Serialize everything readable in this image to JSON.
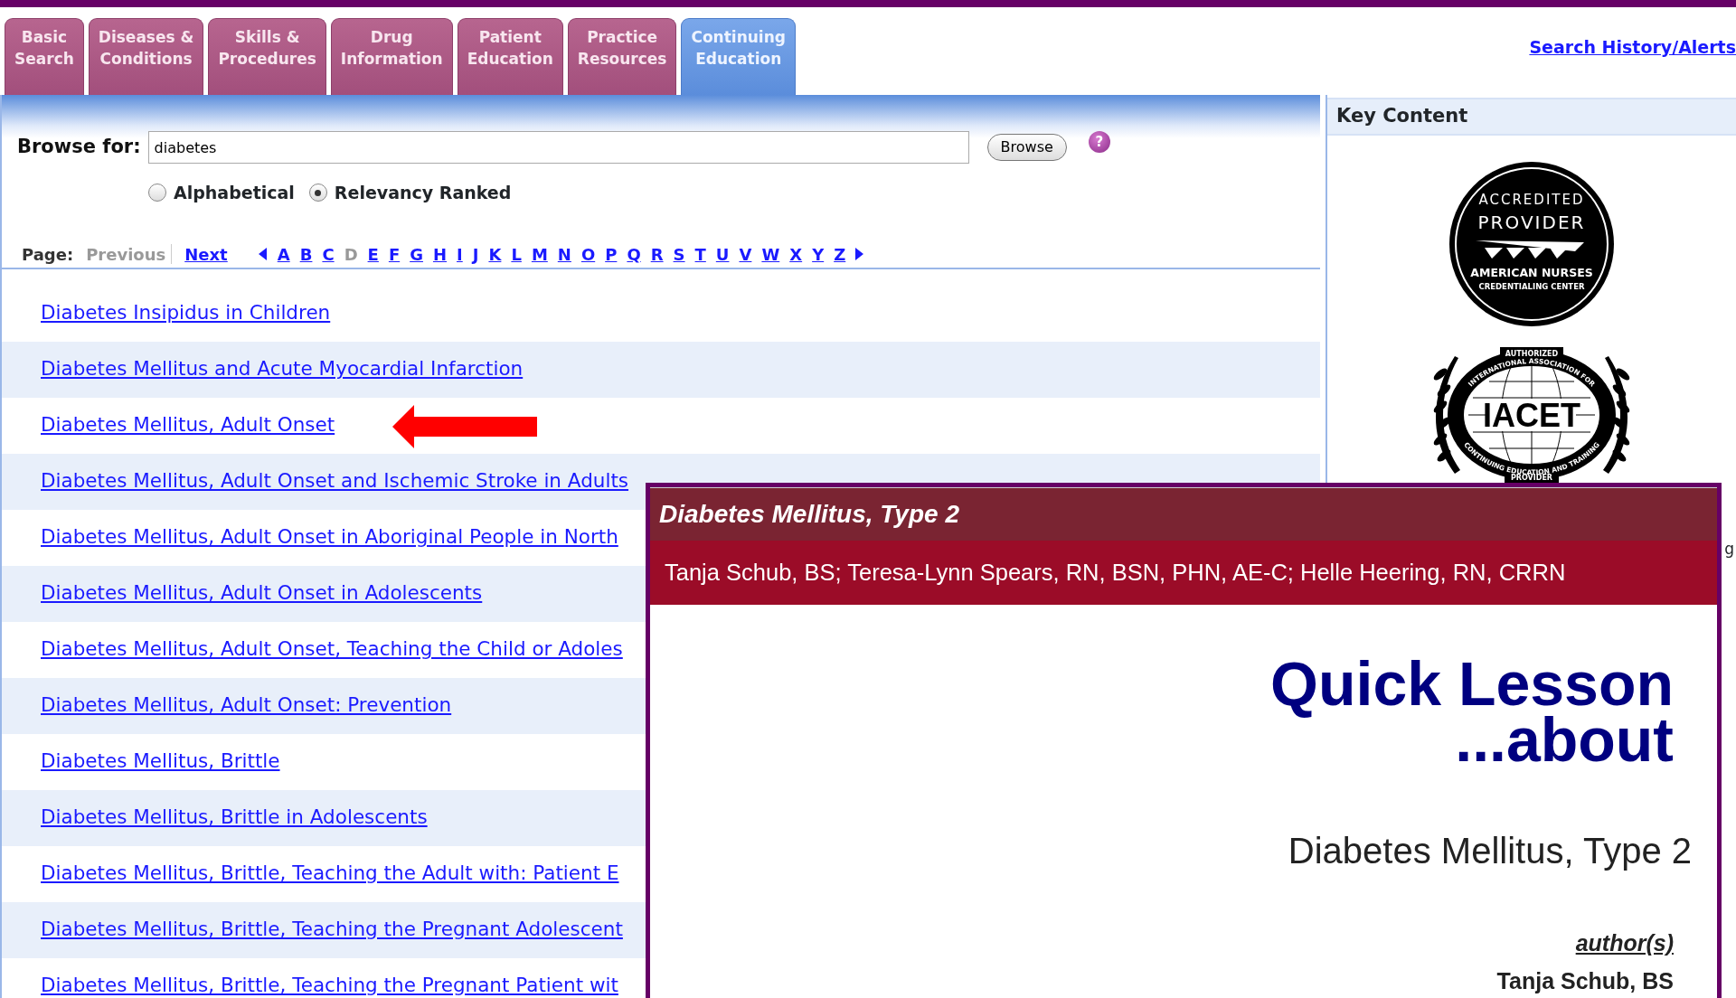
{
  "tabs": [
    {
      "label": "Basic Search",
      "selected": false
    },
    {
      "label": "Diseases & Conditions",
      "selected": false
    },
    {
      "label": "Skills & Procedures",
      "selected": false
    },
    {
      "label": "Drug Information",
      "selected": false
    },
    {
      "label": "Patient Education",
      "selected": false
    },
    {
      "label": "Practice Resources",
      "selected": false
    },
    {
      "label": "Continuing Education",
      "selected": true
    }
  ],
  "header_link": "Search History/Alerts",
  "browse": {
    "label": "Browse for:",
    "value": "diabetes",
    "button": "Browse",
    "help": "?",
    "options": [
      {
        "label": "Alphabetical",
        "selected": false
      },
      {
        "label": "Relevancy Ranked",
        "selected": true
      }
    ]
  },
  "pager": {
    "label": "Page:",
    "previous": {
      "label": "Previous",
      "disabled": true
    },
    "next": {
      "label": "Next",
      "disabled": false
    },
    "letters": [
      {
        "label": "A",
        "disabled": false
      },
      {
        "label": "B",
        "disabled": false
      },
      {
        "label": "C",
        "disabled": false
      },
      {
        "label": "D",
        "disabled": true
      },
      {
        "label": "E",
        "disabled": false
      },
      {
        "label": "F",
        "disabled": false
      },
      {
        "label": "G",
        "disabled": false
      },
      {
        "label": "H",
        "disabled": false
      },
      {
        "label": "I",
        "disabled": false
      },
      {
        "label": "J",
        "disabled": false
      },
      {
        "label": "K",
        "disabled": false
      },
      {
        "label": "L",
        "disabled": false
      },
      {
        "label": "M",
        "disabled": false
      },
      {
        "label": "N",
        "disabled": false
      },
      {
        "label": "O",
        "disabled": false
      },
      {
        "label": "P",
        "disabled": false
      },
      {
        "label": "Q",
        "disabled": false
      },
      {
        "label": "R",
        "disabled": false
      },
      {
        "label": "S",
        "disabled": false
      },
      {
        "label": "T",
        "disabled": false
      },
      {
        "label": "U",
        "disabled": false
      },
      {
        "label": "V",
        "disabled": false
      },
      {
        "label": "W",
        "disabled": false
      },
      {
        "label": "X",
        "disabled": false
      },
      {
        "label": "Y",
        "disabled": false
      },
      {
        "label": "Z",
        "disabled": false
      }
    ]
  },
  "results": [
    {
      "title": "Diabetes Insipidus in Children"
    },
    {
      "title": "Diabetes Mellitus and Acute Myocardial Infarction"
    },
    {
      "title": "Diabetes Mellitus, Adult Onset"
    },
    {
      "title": "Diabetes Mellitus, Adult Onset and Ischemic Stroke in Adults"
    },
    {
      "title": "Diabetes Mellitus, Adult Onset in Aboriginal People in North"
    },
    {
      "title": "Diabetes Mellitus, Adult Onset in Adolescents"
    },
    {
      "title": "Diabetes Mellitus, Adult Onset, Teaching the Child or Adoles"
    },
    {
      "title": "Diabetes Mellitus, Adult Onset: Prevention"
    },
    {
      "title": "Diabetes Mellitus, Brittle"
    },
    {
      "title": "Diabetes Mellitus, Brittle in Adolescents"
    },
    {
      "title": "Diabetes Mellitus, Brittle, Teaching the Adult with: Patient E"
    },
    {
      "title": "Diabetes Mellitus, Brittle, Teaching the Pregnant Adolescent"
    },
    {
      "title": "Diabetes Mellitus, Brittle, Teaching the Pregnant Patient wit"
    }
  ],
  "annotations": [
    {
      "kind": "arrow"
    }
  ],
  "key_content": {
    "title": "Key Content",
    "fragment": "g",
    "logos": [
      {
        "kind": "seal",
        "texts": [
          "ACCREDITED",
          "PROVIDER",
          "AMERICAN NURSES",
          "CREDENTIALING CENTER"
        ]
      },
      {
        "kind": "globe",
        "texts": [
          "AUTHORIZED",
          "INTERNATIONAL ASSOCIATION FOR",
          "IACET",
          "CONTINUING EDUCATION AND TRAINING",
          "PROVIDER"
        ]
      }
    ]
  },
  "popup": {
    "title": "Diabetes Mellitus, Type 2",
    "authors": "Tanja Schub, BS; Teresa-Lynn Spears, RN, BSN, PHN, AE-C; Helle Heering, RN, CRRN",
    "heading": [
      "Quick Lesson",
      "...about"
    ],
    "subject": "Diabetes Mellitus, Type 2",
    "authors_label": "author(s)",
    "first_author": "Tanja Schub, BS"
  }
}
